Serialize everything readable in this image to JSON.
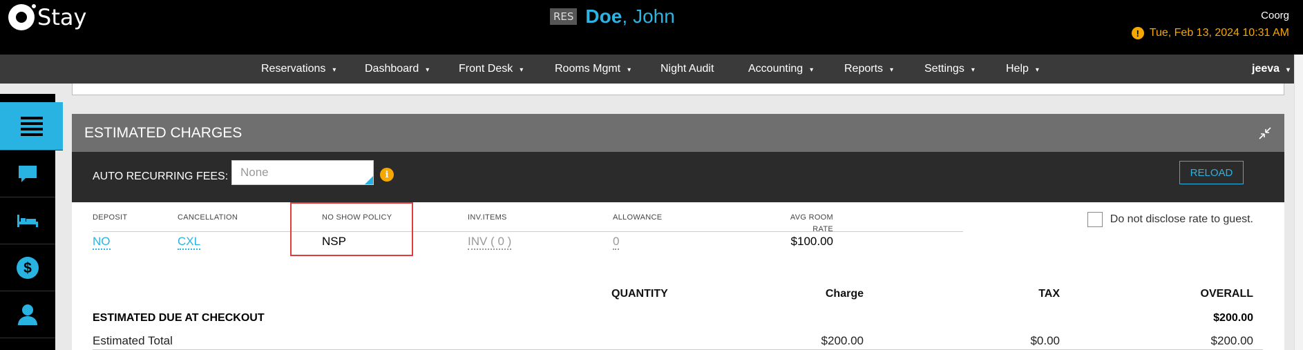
{
  "header": {
    "app_name": "Stay",
    "res_tag": "RES",
    "guest_last": "Doe",
    "guest_sep": ",",
    "guest_first": "John",
    "property": "Coorg",
    "datetime": "Tue, Feb 13, 2024 10:31 AM",
    "warn_symbol": "!"
  },
  "nav": {
    "items": [
      "Reservations",
      "Dashboard",
      "Front Desk",
      "Rooms Mgmt",
      "Night Audit",
      "Accounting",
      "Reports",
      "Settings",
      "Help"
    ],
    "user": "jeeva",
    "caret": "▾"
  },
  "sidebar": {
    "icons": [
      "menu-icon",
      "chat-icon",
      "bed-icon",
      "dollar-icon",
      "user-icon"
    ]
  },
  "panel": {
    "title": "ESTIMATED CHARGES",
    "fees_label": "AUTO RECURRING FEES:",
    "fees_placeholder": "None",
    "info_symbol": "i",
    "reload_label": "RELOAD",
    "disclose_label": "Do not disclose rate to guest.",
    "columns": {
      "deposit": "DEPOSIT",
      "cancellation": "CANCELLATION",
      "no_show": "NO SHOW POLICY",
      "inv_items": "INV.ITEMS",
      "allowance": "ALLOWANCE",
      "avg_rate_1": "AVG ROOM",
      "avg_rate_2": "RATE"
    },
    "values": {
      "deposit": "NO",
      "cancellation": "CXL",
      "no_show": "NSP",
      "inv_items": "INV ( 0 )",
      "allowance": "0",
      "avg_rate": "$100.00"
    },
    "table": {
      "headers": {
        "quantity": "QUANTITY",
        "charge": "Charge",
        "tax": "TAX",
        "overall": "OVERALL"
      },
      "due_label": "ESTIMATED DUE AT CHECKOUT",
      "due_overall": "$200.00",
      "total_label": "Estimated Total",
      "total_charge": "$200.00",
      "total_tax": "$0.00",
      "total_overall": "$200.00"
    }
  },
  "colors": {
    "accent": "#29b3e3",
    "warning": "#f6a800",
    "highlight": "#e03b3b"
  }
}
